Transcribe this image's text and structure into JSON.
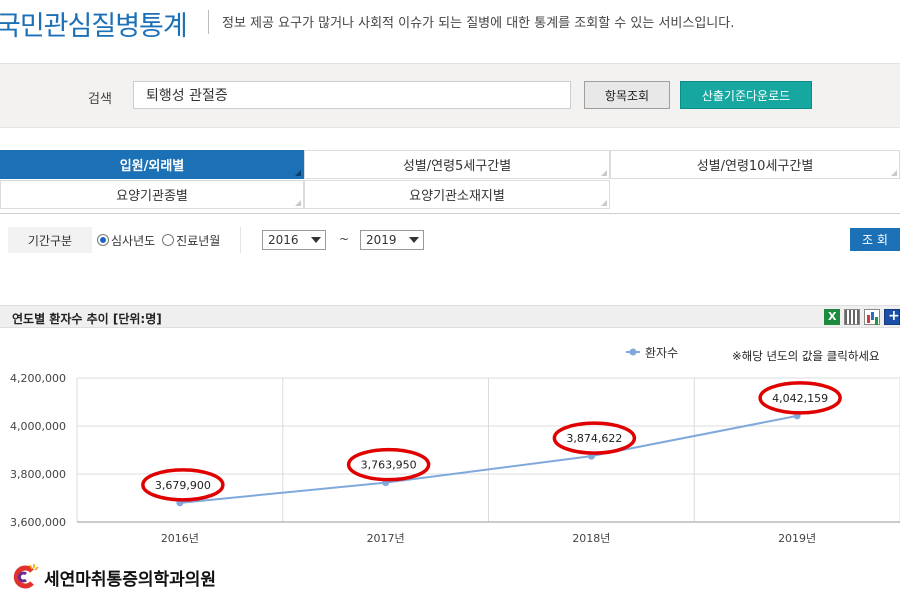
{
  "header": {
    "title": "국민관심질병통계",
    "description": "정보 제공 요구가 많거나 사회적 이슈가 되는 질병에 대한 통계를 조회할 수 있는 서비스입니다."
  },
  "search": {
    "label": "검색",
    "value": "퇴행성 관절증",
    "lookup_button": "항목조회",
    "download_button": "산출기준다운로드"
  },
  "tabs": [
    {
      "label": "입원/외래별",
      "active": true
    },
    {
      "label": "성별/연령5세구간별",
      "active": false
    },
    {
      "label": "성별/연령10세구간별",
      "active": false
    },
    {
      "label": "요양기관종별",
      "active": false
    },
    {
      "label": "요양기관소재지별",
      "active": false
    }
  ],
  "filter": {
    "label": "기간구분",
    "radio_review_year": "심사년도",
    "radio_treatment_month": "진료년월",
    "selected_radio": "심사년도",
    "from_year": "2016",
    "tilde": "~",
    "to_year": "2019",
    "query_button": "조 회"
  },
  "panel": {
    "title": "연도별 환자수 추이 [단위:명]",
    "icons": [
      "excel-icon",
      "grid-icon",
      "bar-chart-icon",
      "plus-icon"
    ]
  },
  "chart_data": {
    "type": "line",
    "categories": [
      "2016년",
      "2017년",
      "2018년",
      "2019년"
    ],
    "series": [
      {
        "name": "환자수",
        "values": [
          3679900,
          3763950,
          3874622,
          4042159
        ],
        "color": "#7fa9dc"
      }
    ],
    "data_labels": [
      "3,679,900",
      "3,763,950",
      "3,874,622",
      "4,042,159"
    ],
    "yticks": [
      "4,200,000",
      "4,000,000",
      "3,800,000",
      "3,600,000"
    ],
    "ylim": [
      3600000,
      4200000
    ],
    "note": "※해당 년도의 값을 클릭하세요",
    "legend_position": "top-right",
    "highlight_color": "#e00000",
    "grid": true
  },
  "footer": {
    "logo_text": "세연마취통증의학과의원"
  }
}
